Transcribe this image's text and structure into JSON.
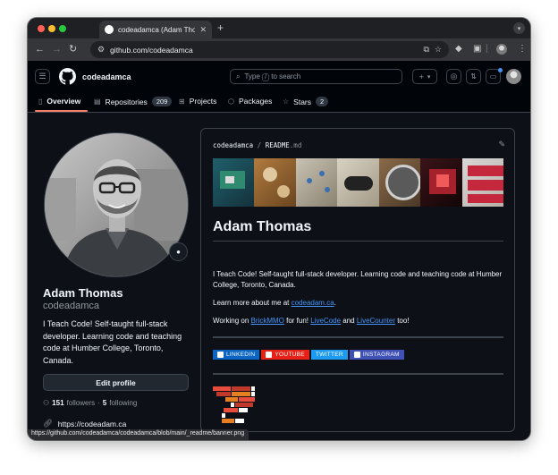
{
  "browser": {
    "tab_title": "codeadamca (Adam Thomas)",
    "tab_close": "✕",
    "new_tab": "+",
    "url": "github.com/codeadamca",
    "status_url": "https://github.com/codeadamca/codeadamca/blob/main/_readme/banner.png"
  },
  "header": {
    "username": "codeadamca",
    "search_prefix": "Type",
    "search_key": "/",
    "search_suffix": "to search",
    "plus_label": "+",
    "plus_caret": "▾"
  },
  "tabs": [
    {
      "label": "Overview",
      "icon": "book-icon"
    },
    {
      "label": "Repositories",
      "count": "209",
      "icon": "repo-icon"
    },
    {
      "label": "Projects",
      "icon": "table-icon"
    },
    {
      "label": "Packages",
      "icon": "package-icon"
    },
    {
      "label": "Stars",
      "count": "2",
      "icon": "star-icon"
    }
  ],
  "profile": {
    "name": "Adam Thomas",
    "login": "codeadamca",
    "bio": "I Teach Code! Self-taught full-stack developer. Learning code and teaching code at Humber College, Toronto, Canada.",
    "edit_button": "Edit profile",
    "followers_count": "151",
    "followers_label": "followers",
    "separator": "·",
    "following_count": "5",
    "following_label": "following",
    "website": "https://codeadam.ca"
  },
  "readme": {
    "owner": "codeadamca",
    "separator": "/",
    "file_name": "README",
    "file_ext": ".md",
    "heading": "Adam Thomas",
    "intro": "I Teach Code! Self-taught full-stack developer. Learning code and teaching code at Humber College, Toronto, Canada.",
    "learn_more_prefix": "Learn more about me at ",
    "learn_more_link": "codeadam.ca",
    "learn_more_suffix": ".",
    "working_prefix": "Working on ",
    "project_1": "BrickMMO",
    "working_mid_1": " for fun! ",
    "project_2": "LiveCode",
    "working_mid_2": " and ",
    "project_3": "LiveCounter",
    "working_suffix": " too!",
    "badges": [
      {
        "label": "LINKEDIN",
        "color": "#0a66c2"
      },
      {
        "label": "YOUTUBE",
        "color": "#e62117"
      },
      {
        "label": "TWITTER",
        "color": "#1d9bf0"
      },
      {
        "label": "INSTAGRAM",
        "color": "#3f51b5"
      }
    ]
  }
}
